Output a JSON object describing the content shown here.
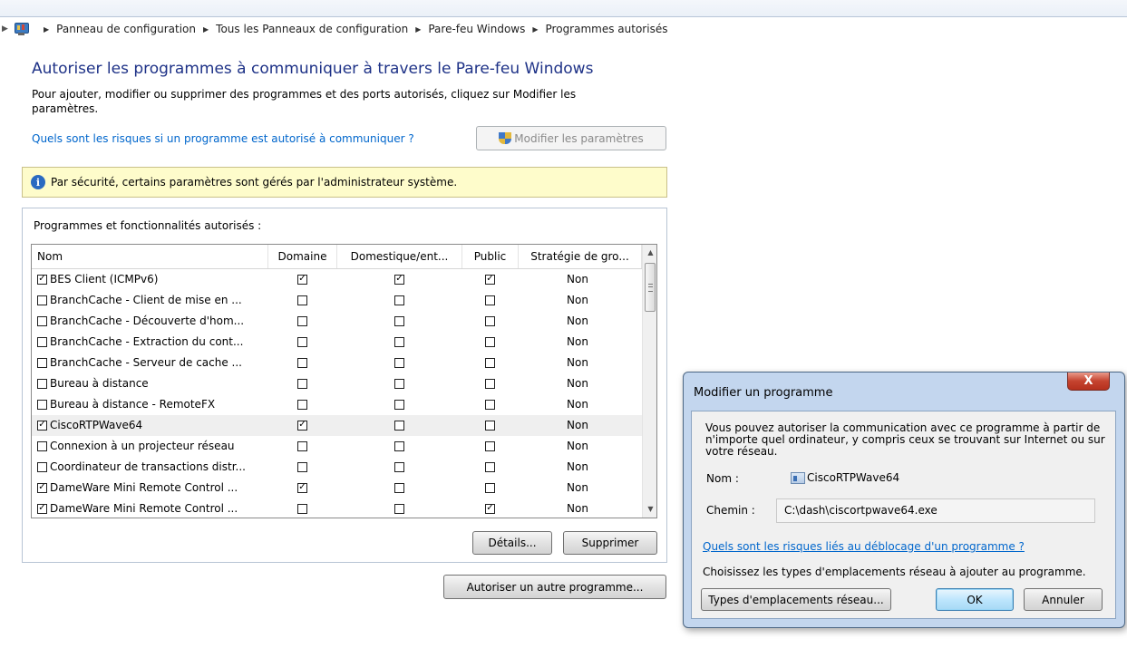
{
  "breadcrumb": {
    "items": [
      "Panneau de configuration",
      "Tous les Panneaux de configuration",
      "Pare-feu Windows",
      "Programmes autorisés"
    ]
  },
  "page": {
    "title": "Autoriser les programmes à communiquer à travers le Pare-feu Windows",
    "intro": "Pour ajouter, modifier ou supprimer des programmes et des ports autorisés, cliquez sur Modifier les paramètres.",
    "risk_link": "Quels sont les risques si un programme est autorisé à communiquer ?",
    "modify_button": "Modifier les paramètres",
    "info_message": "Par sécurité, certains paramètres sont gérés par l'administrateur système.",
    "group_label": "Programmes et fonctionnalités autorisés :",
    "details_button": "Détails...",
    "delete_button": "Supprimer",
    "allow_other_button": "Autoriser un autre programme..."
  },
  "table": {
    "columns": [
      "Nom",
      "Domaine",
      "Domestique/ent...",
      "Public",
      "Stratégie de gro..."
    ],
    "rows": [
      {
        "name": "BES Client (ICMPv6)",
        "enabled": true,
        "domain": true,
        "home": true,
        "public": true,
        "policy": "Non"
      },
      {
        "name": "BranchCache - Client de mise en ...",
        "enabled": false,
        "domain": false,
        "home": false,
        "public": false,
        "policy": "Non"
      },
      {
        "name": "BranchCache - Découverte d'hom...",
        "enabled": false,
        "domain": false,
        "home": false,
        "public": false,
        "policy": "Non"
      },
      {
        "name": "BranchCache - Extraction du cont...",
        "enabled": false,
        "domain": false,
        "home": false,
        "public": false,
        "policy": "Non"
      },
      {
        "name": "BranchCache - Serveur de cache ...",
        "enabled": false,
        "domain": false,
        "home": false,
        "public": false,
        "policy": "Non"
      },
      {
        "name": "Bureau à distance",
        "enabled": false,
        "domain": false,
        "home": false,
        "public": false,
        "policy": "Non"
      },
      {
        "name": "Bureau à distance - RemoteFX",
        "enabled": false,
        "domain": false,
        "home": false,
        "public": false,
        "policy": "Non"
      },
      {
        "name": "CiscoRTPWave64",
        "enabled": true,
        "domain": true,
        "home": false,
        "public": false,
        "policy": "Non",
        "selected": true
      },
      {
        "name": "Connexion à un projecteur réseau",
        "enabled": false,
        "domain": false,
        "home": false,
        "public": false,
        "policy": "Non"
      },
      {
        "name": "Coordinateur de transactions distr...",
        "enabled": false,
        "domain": false,
        "home": false,
        "public": false,
        "policy": "Non"
      },
      {
        "name": "DameWare Mini Remote Control ...",
        "enabled": true,
        "domain": true,
        "home": false,
        "public": false,
        "policy": "Non"
      },
      {
        "name": "DameWare Mini Remote Control ...",
        "enabled": true,
        "domain": false,
        "home": false,
        "public": true,
        "policy": "Non"
      }
    ]
  },
  "dialog": {
    "title": "Modifier un programme",
    "close_glyph": "X",
    "description": "Vous pouvez autoriser la communication avec ce programme à partir de n'importe quel ordinateur, y compris ceux se trouvant sur Internet ou sur votre réseau.",
    "name_label": "Nom :",
    "name_value": "CiscoRTPWave64",
    "path_label": "Chemin :",
    "path_value": "C:\\dash\\ciscortpwave64.exe",
    "risk_link": "Quels sont les risques liés au déblocage d'un programme ?",
    "instruction": "Choisissez les types d'emplacements réseau à ajouter au programme.",
    "network_types_button": "Types d'emplacements réseau...",
    "ok_button": "OK",
    "cancel_button": "Annuler"
  },
  "colors": {
    "title": "#1e3287",
    "link": "#0066cc",
    "info_bg": "#fefccb",
    "dialog_frame": "#c3d6ee",
    "close_button": "#c5432f"
  }
}
